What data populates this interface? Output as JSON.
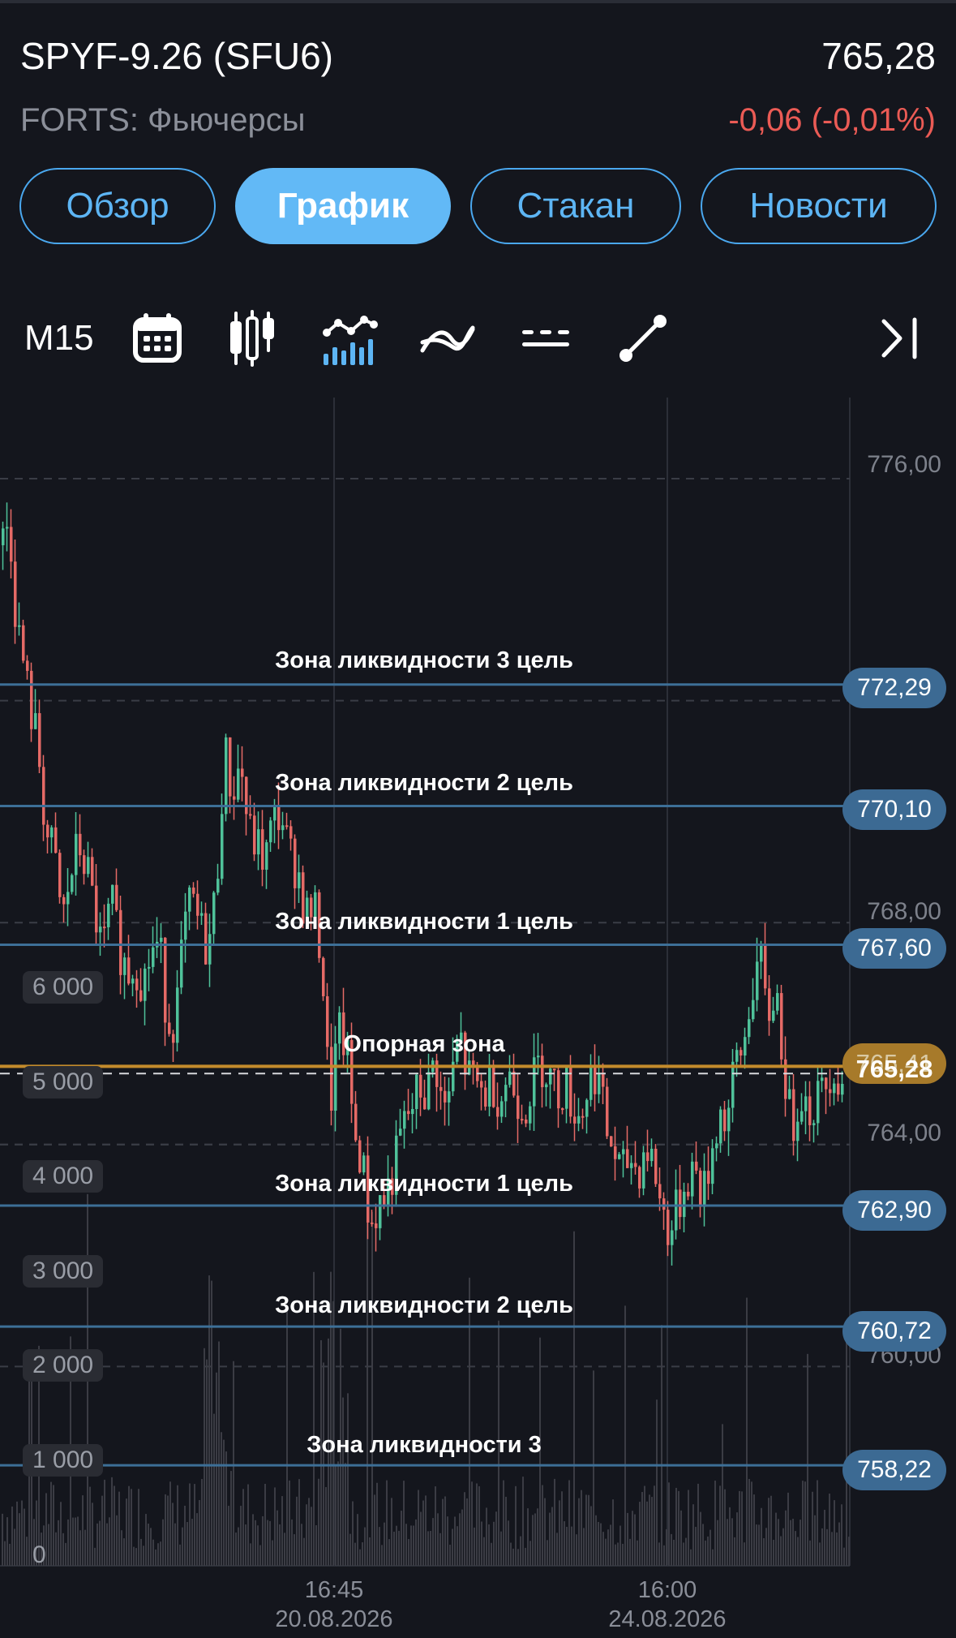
{
  "header": {
    "title": "SPYF-9.26 (SFU6)",
    "price": "765,28",
    "exchange": "FORTS: Фьючерсы",
    "change": "-0,06 (-0,01%)"
  },
  "tabs": [
    {
      "label": "Обзор",
      "active": false
    },
    {
      "label": "График",
      "active": true
    },
    {
      "label": "Стакан",
      "active": false
    },
    {
      "label": "Новости",
      "active": false
    }
  ],
  "toolbar": {
    "timeframe": "M15",
    "icons": [
      "calendar-icon",
      "candlestick-icon",
      "indicators-icon",
      "moving-average-icon",
      "horizontal-lines-icon",
      "trendline-icon",
      "scroll-to-end-icon"
    ]
  },
  "colors": {
    "background": "#14161d",
    "accent": "#5db5f4",
    "negative": "#eb5b55",
    "up_candle": "#4fc29a",
    "down_candle": "#e56a66",
    "level_line": "#3d6f97",
    "price_line": "#c38b2c"
  },
  "chart_data": {
    "type": "candlestick",
    "ylim": [
      756.5,
      777.0
    ],
    "price_axis": [
      "776,00",
      "768,00",
      "764,00",
      "760,00"
    ],
    "volume_axis": [
      "6 000",
      "5 000",
      "4 000",
      "3 000",
      "2 000",
      "1 000",
      "0"
    ],
    "time_axis": [
      {
        "time": "16:45",
        "date": "20.08.2026"
      },
      {
        "time": "16:00",
        "date": "24.08.2026"
      }
    ],
    "levels": [
      {
        "zone": "Зона ликвидности 3 цель",
        "value": "772,29"
      },
      {
        "zone": "Зона ликвидности 2 цель",
        "value": "770,10"
      },
      {
        "zone": "Зона ликвидности 1 цель",
        "value": "767,60"
      },
      {
        "zone": "Зона ликвидности 1 цель",
        "value": "762,90"
      },
      {
        "zone": "Зона ликвидности 2 цель",
        "value": "760,72"
      },
      {
        "zone": "Зона ликвидности 3",
        "value": "758,22"
      }
    ],
    "support_zone": {
      "label": "Опорная зона",
      "value": "765,41"
    },
    "last_price": "765,28",
    "price_path": [
      [
        0,
        774.8
      ],
      [
        10,
        775.3
      ],
      [
        18,
        773.5
      ],
      [
        25,
        772.9
      ],
      [
        35,
        771.9
      ],
      [
        45,
        771.2
      ],
      [
        55,
        769.6
      ],
      [
        65,
        769.2
      ],
      [
        75,
        768.0
      ],
      [
        85,
        768.8
      ],
      [
        95,
        769.4
      ],
      [
        105,
        769.0
      ],
      [
        115,
        768.2
      ],
      [
        125,
        767.4
      ],
      [
        135,
        768.4
      ],
      [
        145,
        767.6
      ],
      [
        155,
        767.1
      ],
      [
        165,
        767.3
      ],
      [
        175,
        766.9
      ],
      [
        185,
        767.5
      ],
      [
        195,
        767.6
      ],
      [
        205,
        766.2
      ],
      [
        215,
        766.3
      ],
      [
        225,
        767.8
      ],
      [
        235,
        768.4
      ],
      [
        245,
        767.9
      ],
      [
        255,
        767.5
      ],
      [
        265,
        768.6
      ],
      [
        275,
        771.1
      ],
      [
        285,
        770.3
      ],
      [
        295,
        770.9
      ],
      [
        305,
        769.6
      ],
      [
        315,
        769.4
      ],
      [
        325,
        769.1
      ],
      [
        335,
        769.8
      ],
      [
        345,
        770.0
      ],
      [
        355,
        769.2
      ],
      [
        365,
        769.0
      ],
      [
        375,
        768.1
      ],
      [
        385,
        768.3
      ],
      [
        395,
        767.4
      ],
      [
        405,
        764.6
      ],
      [
        415,
        766.0
      ],
      [
        425,
        765.8
      ],
      [
        435,
        764.2
      ],
      [
        445,
        763.7
      ],
      [
        455,
        762.5
      ],
      [
        465,
        762.9
      ],
      [
        475,
        763.1
      ],
      [
        485,
        763.6
      ],
      [
        495,
        764.3
      ],
      [
        505,
        764.6
      ],
      [
        515,
        765.0
      ],
      [
        525,
        764.9
      ],
      [
        535,
        765.6
      ],
      [
        545,
        764.5
      ],
      [
        555,
        765.1
      ],
      [
        565,
        766.0
      ],
      [
        575,
        765.2
      ],
      [
        585,
        765.1
      ],
      [
        595,
        764.9
      ],
      [
        605,
        765.2
      ],
      [
        615,
        764.8
      ],
      [
        625,
        765.3
      ],
      [
        635,
        764.9
      ],
      [
        645,
        764.7
      ],
      [
        655,
        765.1
      ],
      [
        665,
        765.5
      ],
      [
        675,
        765.3
      ],
      [
        685,
        764.9
      ],
      [
        695,
        765.1
      ],
      [
        705,
        764.7
      ],
      [
        715,
        764.5
      ],
      [
        725,
        765.2
      ],
      [
        735,
        765.4
      ],
      [
        745,
        764.3
      ],
      [
        755,
        763.9
      ],
      [
        765,
        763.4
      ],
      [
        775,
        763.8
      ],
      [
        785,
        763.5
      ],
      [
        795,
        764.0
      ],
      [
        805,
        763.6
      ],
      [
        815,
        762.8
      ],
      [
        825,
        762.4
      ],
      [
        835,
        762.9
      ],
      [
        845,
        763.4
      ],
      [
        855,
        763.6
      ],
      [
        865,
        763.0
      ],
      [
        875,
        763.8
      ],
      [
        885,
        764.6
      ],
      [
        895,
        764.4
      ],
      [
        905,
        765.4
      ],
      [
        915,
        765.7
      ],
      [
        925,
        766.8
      ],
      [
        935,
        767.4
      ],
      [
        945,
        766.2
      ],
      [
        955,
        766.9
      ],
      [
        965,
        765.4
      ],
      [
        975,
        764.2
      ],
      [
        985,
        765.1
      ],
      [
        995,
        764.6
      ],
      [
        1005,
        764.8
      ],
      [
        1015,
        765.0
      ],
      [
        1025,
        765.5
      ],
      [
        1035,
        765.1
      ],
      [
        1045,
        765.3
      ]
    ]
  }
}
